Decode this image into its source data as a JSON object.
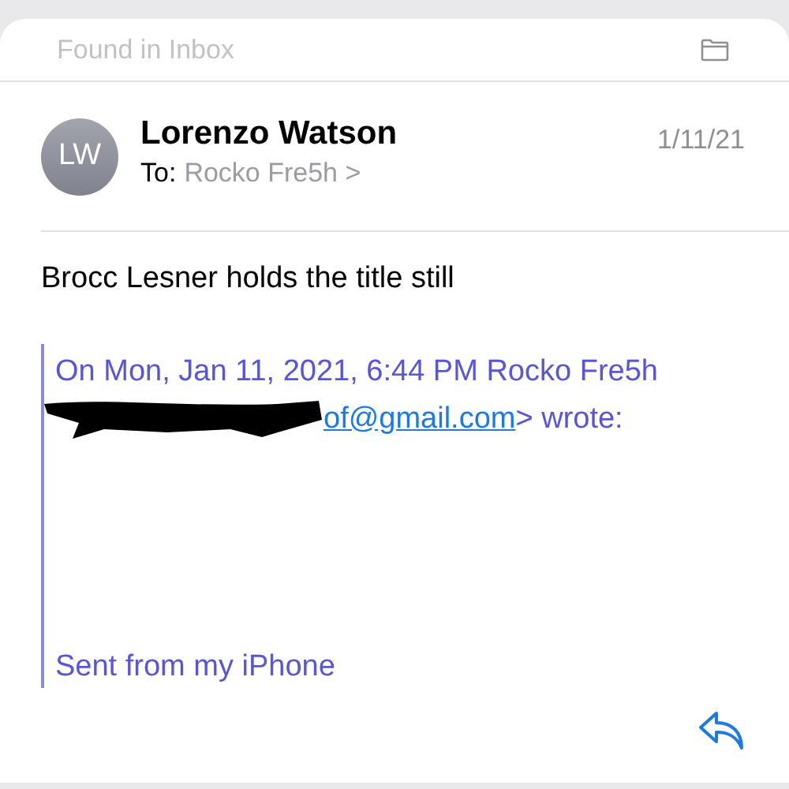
{
  "mailbox_banner": {
    "label": "Found in Inbox"
  },
  "message": {
    "avatar": "LW",
    "sender": "Lorenzo Watson",
    "to_label": "To:",
    "recipient": "Rocko Fre5h",
    "recipient_chevron": ">",
    "date": "1/11/21"
  },
  "body": "Brocc Lesner holds the title still",
  "quote": {
    "attribution": "On Mon, Jan 11, 2021, 6:44 PM Rocko Fre5h",
    "email_link": "of@gmail.com",
    "after_link": "> wrote:",
    "redacted": true,
    "signature": "Sent from my iPhone"
  }
}
